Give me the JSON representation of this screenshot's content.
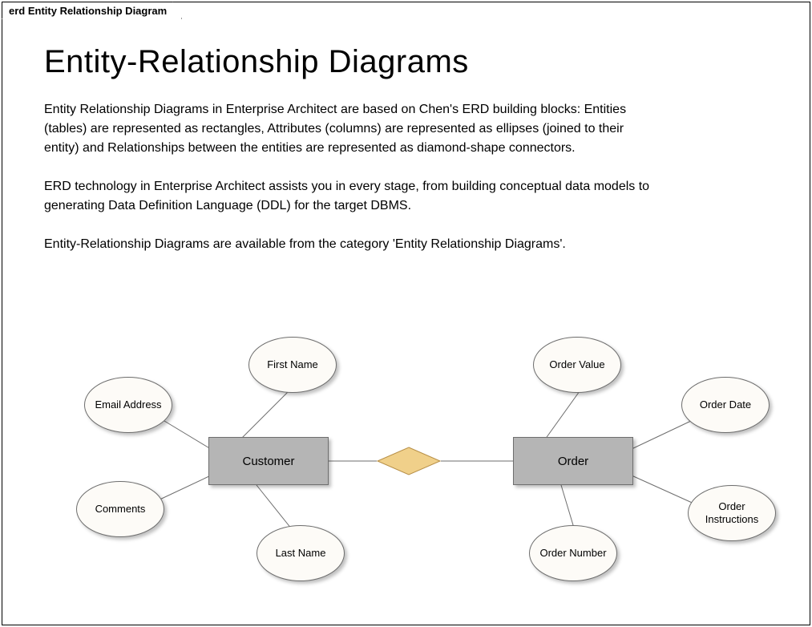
{
  "tab_label": "erd Entity Relationship Diagram",
  "title": "Entity-Relationship Diagrams",
  "para1": "Entity Relationship Diagrams in Enterprise Architect are based on Chen's ERD building blocks: Entities (tables) are represented as rectangles, Attributes (columns) are represented as ellipses (joined to their entity) and Relationships between the entities are represented as diamond-shape connectors.",
  "para2": "ERD technology in Enterprise Architect assists you in every stage, from building conceptual data models to generating Data Definition Language (DDL) for the target DBMS.",
  "para3": "Entity-Relationship Diagrams are available from the category 'Entity Relationship Diagrams'.",
  "entities": {
    "customer": "Customer",
    "order": "Order"
  },
  "attributes": {
    "first_name": "First Name",
    "email_address": "Email Address",
    "comments": "Comments",
    "last_name": "Last Name",
    "order_value": "Order Value",
    "order_date": "Order Date",
    "order_number": "Order Number",
    "order_instructions": "Order Instructions"
  }
}
